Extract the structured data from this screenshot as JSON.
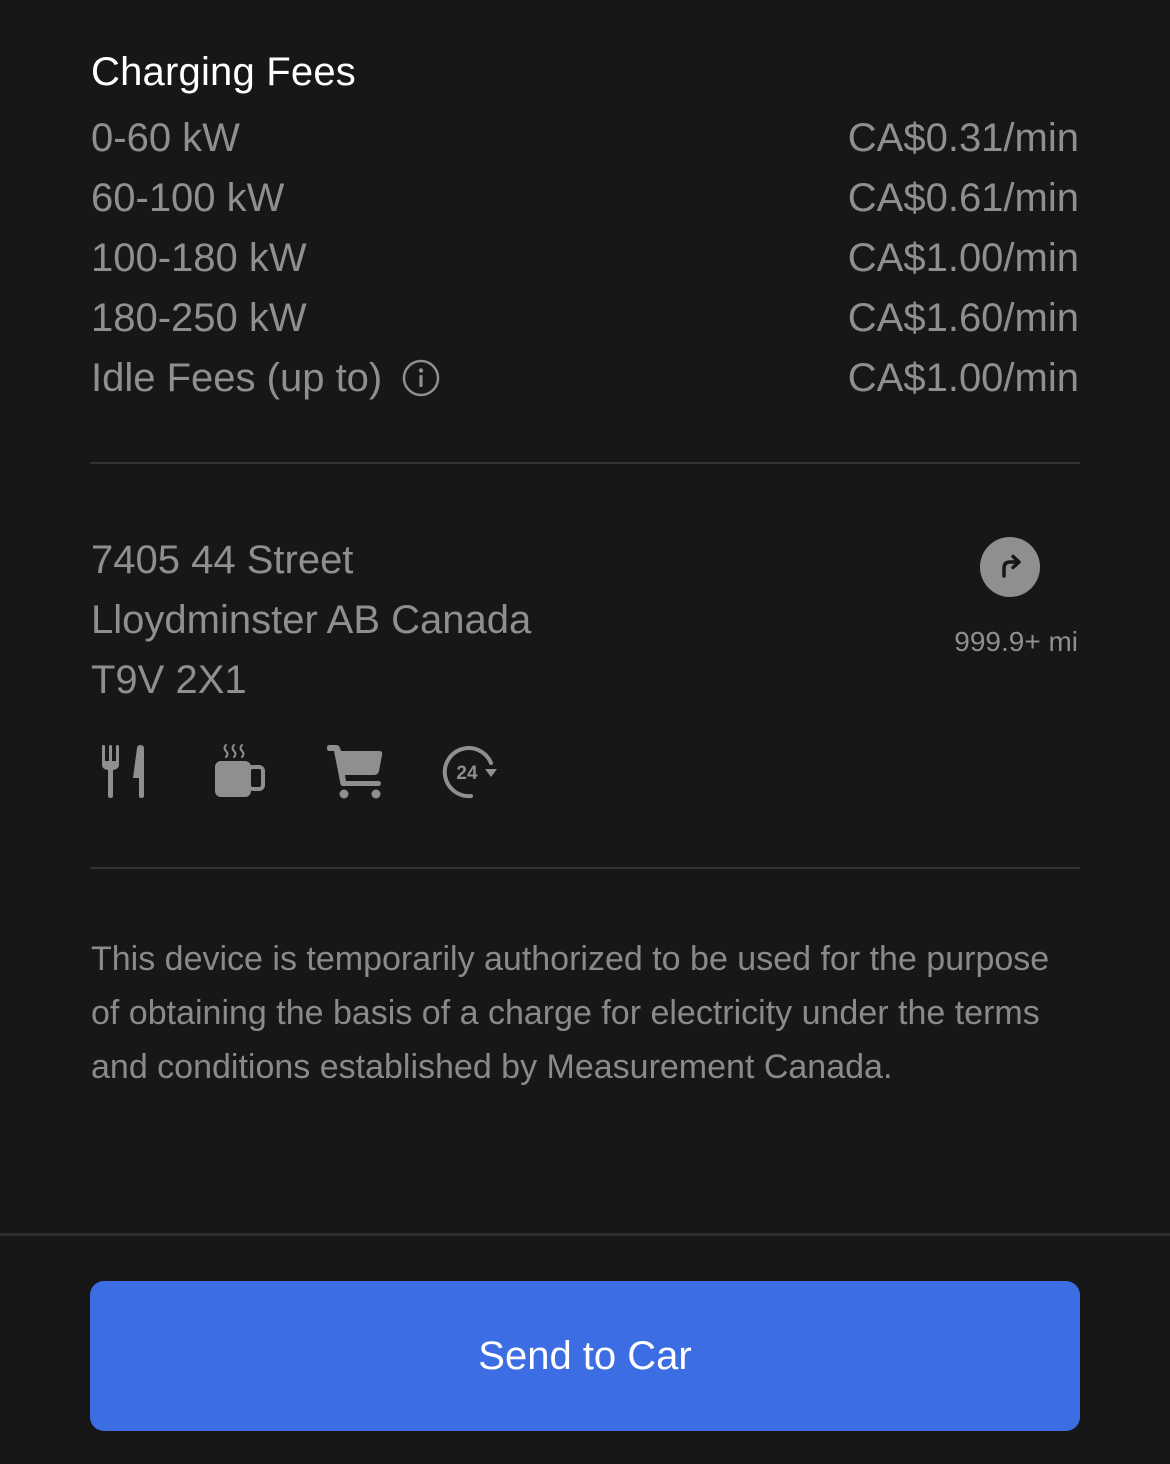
{
  "section_title": "Charging Fees",
  "fees": [
    {
      "label": "0-60 kW",
      "price": "CA$0.31/min"
    },
    {
      "label": "60-100 kW",
      "price": "CA$0.61/min"
    },
    {
      "label": "100-180 kW",
      "price": "CA$1.00/min"
    },
    {
      "label": "180-250 kW",
      "price": "CA$1.60/min"
    },
    {
      "label": "Idle Fees (up to)",
      "price": "CA$1.00/min",
      "icon": "info-icon"
    }
  ],
  "location": {
    "address_line1": "7405 44 Street",
    "address_line2": "Lloydminster AB Canada",
    "address_line3": "T9V 2X1",
    "distance": "999.9+ mi",
    "nav_icon": "turn-right-arrow-icon"
  },
  "amenities": [
    {
      "icon": "restaurant-icon",
      "name": "Restaurants"
    },
    {
      "icon": "coffee-icon",
      "name": "Coffee"
    },
    {
      "icon": "shopping-cart-icon",
      "name": "Shopping"
    },
    {
      "icon": "24-hours-icon",
      "name": "Open 24 hours"
    }
  ],
  "disclaimer": "This device is temporarily authorized to be used for the purpose of obtaining the basis of a charge for electricity under the terms and conditions established by Measurement Canada.",
  "actions": {
    "send_to_car_label": "Send to Car"
  },
  "colors": {
    "background": "#171717",
    "primary_button": "#3d6de2",
    "text_secondary": "#8f8f8f",
    "text_primary": "#ffffff"
  }
}
